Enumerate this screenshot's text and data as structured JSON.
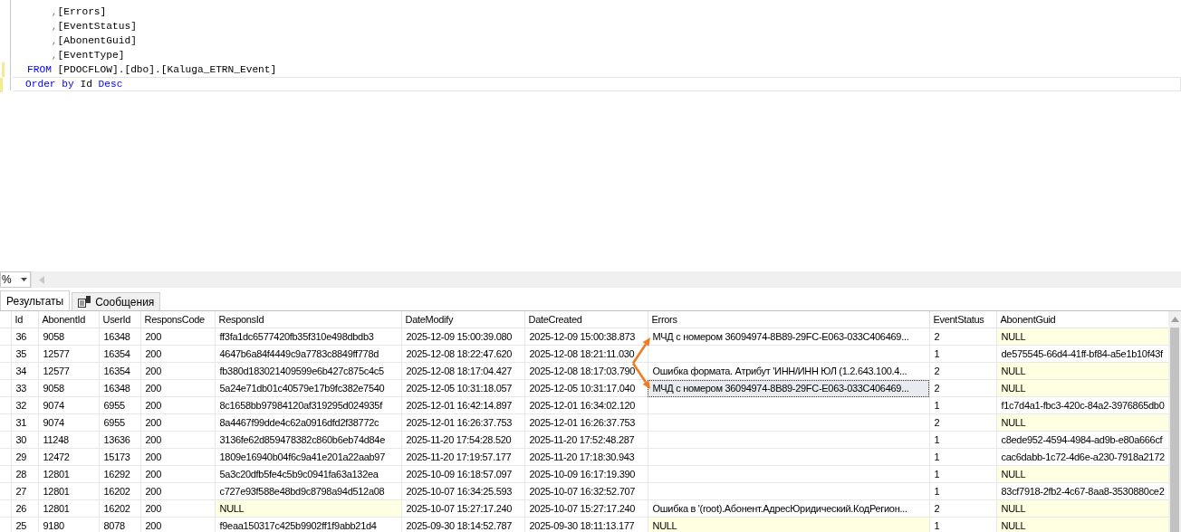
{
  "editor": {
    "lines": [
      {
        "tokens": [
          {
            "text": "    ,",
            "kind": "punct"
          },
          {
            "text": "[Errors]",
            "kind": "plain"
          }
        ],
        "changed": false,
        "current": false
      },
      {
        "tokens": [
          {
            "text": "    ,",
            "kind": "punct"
          },
          {
            "text": "[EventStatus]",
            "kind": "plain"
          }
        ],
        "changed": false,
        "current": false
      },
      {
        "tokens": [
          {
            "text": "    ,",
            "kind": "punct"
          },
          {
            "text": "[AbonentGuid]",
            "kind": "plain"
          }
        ],
        "changed": false,
        "current": false
      },
      {
        "tokens": [
          {
            "text": "    ,",
            "kind": "punct"
          },
          {
            "text": "[EventType]",
            "kind": "plain"
          }
        ],
        "changed": false,
        "current": false
      },
      {
        "tokens": [
          {
            "text": "FROM",
            "kind": "keyword"
          },
          {
            "text": " [PDOCFLOW].[dbo].[Kaluga_ETRN_Event]",
            "kind": "plain"
          }
        ],
        "changed": true,
        "current": false
      },
      {
        "tokens": [
          {
            "text": "Order by",
            "kind": "keyword"
          },
          {
            "text": " Id ",
            "kind": "plain"
          },
          {
            "text": "Desc",
            "kind": "keyword"
          }
        ],
        "changed": true,
        "current": true
      }
    ]
  },
  "zoom": {
    "value": "%"
  },
  "tabs": [
    {
      "label": "Результаты",
      "selected": true,
      "icon": false
    },
    {
      "label": "Сообщения",
      "selected": false,
      "icon": true
    }
  ],
  "grid": {
    "columns": [
      "Id",
      "AbonentId",
      "UserId",
      "ResponsCode",
      "ResponsId",
      "DateModify",
      "DateCreated",
      "Errors",
      "EventStatus",
      "AbonentGuid"
    ],
    "rows": [
      [
        "36",
        "9058",
        "16348",
        "200",
        "ff3fa1dc6577420fb35f310e498dbdb3",
        "2025-12-09 15:00:39.080",
        "2025-12-09 15:00:38.873",
        {
          "text": "МЧД с номером 36094974-8B89-29FC-E063-033C406469...",
          "arrow": true
        },
        "2",
        {
          "text": "NULL",
          "null": true
        }
      ],
      [
        "35",
        "12577",
        "16354",
        "200",
        "4647b6a84f4449c9a7783c8849ff778d",
        "2025-12-08 18:22:47.620",
        "2025-12-08 18:21:11.030",
        null,
        "1",
        "de575545-66d4-41ff-bf84-a5e1b10f43f"
      ],
      [
        "34",
        "12577",
        "16354",
        "200",
        "fb380d183021409599e6b427c875c4c5",
        "2025-12-08 18:17:04.427",
        "2025-12-08 18:17:03.790",
        "Ошибка формата. Атрибут 'ИНН/ИНН ЮЛ (1.2.643.100.4...",
        "2",
        {
          "text": "NULL",
          "null": true
        }
      ],
      [
        "33",
        "9058",
        "16348",
        "200",
        "5a24e71db01c40579e17b9fc382e7540",
        "2025-12-05 10:31:18.057",
        "2025-12-05 10:31:17.040",
        {
          "text": "МЧД с номером 36094974-8B89-29FC-E063-033C406469...",
          "arrow": true,
          "focused": true
        },
        "2",
        {
          "text": "NULL",
          "null": true
        }
      ],
      [
        "32",
        "9074",
        "6955",
        "200",
        "8c1658bb97984120af319295d024935f",
        "2025-12-01 16:42:14.897",
        "2025-12-01 16:34:02.120",
        null,
        "1",
        "f1c7d4a1-fbc3-420c-84a2-3976865db0"
      ],
      [
        "31",
        "9074",
        "6955",
        "200",
        "8a4467f99dde4c62a0916dfd2f38772c",
        "2025-12-01 16:26:37.753",
        "2025-12-01 16:26:37.753",
        null,
        "2",
        {
          "text": "NULL",
          "null": true
        }
      ],
      [
        "30",
        "11248",
        "13636",
        "200",
        "3136fe62d859478382c860b6eb74d84e",
        "2025-11-20 17:54:28.520",
        "2025-11-20 17:52:48.287",
        null,
        "1",
        "c8ede952-4594-4984-ad9b-e80a666cf"
      ],
      [
        "29",
        "12472",
        "15173",
        "200",
        "1809e16940b04f6c9a41e201a22aab97",
        "2025-11-20 17:19:57.177",
        "2025-11-20 17:18:30.943",
        null,
        "1",
        "cac6dabb-1c72-4d6e-a230-7918a2172"
      ],
      [
        "28",
        "12801",
        "16292",
        "200",
        "5a3c20dfb5fe4c5b9c0941fa63a132ea",
        "2025-10-09 16:18:57.097",
        "2025-10-09 16:17:19.390",
        null,
        "1",
        {
          "text": "NULL",
          "null": true
        }
      ],
      [
        "27",
        "12801",
        "16202",
        "200",
        "c727e93f588e48bd9c8798a94d512a08",
        "2025-10-07 16:34:25.593",
        "2025-10-07 16:32:52.707",
        null,
        "1",
        "83cf7918-2fb2-4c67-8aa8-3530880ce2"
      ],
      [
        "26",
        "12801",
        "16202",
        "200",
        {
          "text": "NULL",
          "null": true
        },
        "2025-10-07 15:27:17.240",
        "2025-10-07 15:27:17.240",
        "Ошибка в '(root).Абонент.АдресЮридический.КодРегион...",
        "2",
        {
          "text": "NULL",
          "null": true
        }
      ],
      [
        "25",
        "9180",
        "8078",
        "200",
        "f9eaa150317c425b9902ff1f9abb21d4",
        "2025-09-30 18:14:52.787",
        "2025-09-30 18:11:13.177",
        {
          "text": "NULL",
          "null": true
        },
        "1",
        {
          "text": "NULL",
          "null": true
        }
      ]
    ]
  }
}
